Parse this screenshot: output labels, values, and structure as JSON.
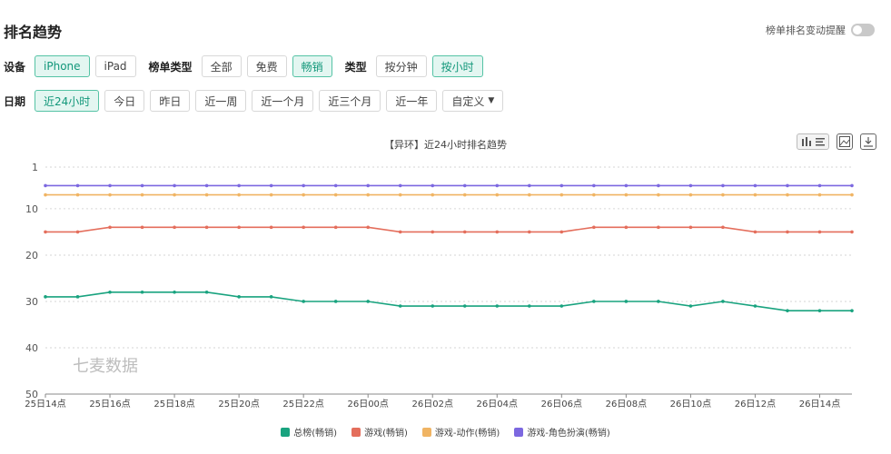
{
  "header": {
    "title": "排名趋势",
    "notify_label": "榜单排名变动提醒"
  },
  "filters": {
    "device_label": "设备",
    "devices": [
      {
        "label": "iPhone",
        "active": true
      },
      {
        "label": "iPad",
        "active": false
      }
    ],
    "list_type_label": "榜单类型",
    "list_types": [
      {
        "label": "全部",
        "active": false
      },
      {
        "label": "免费",
        "active": false
      },
      {
        "label": "畅销",
        "active": true
      }
    ],
    "type_label": "类型",
    "types": [
      {
        "label": "按分钟",
        "active": false
      },
      {
        "label": "按小时",
        "active": true
      }
    ],
    "date_label": "日期",
    "dates": [
      {
        "label": "近24小时",
        "active": true
      },
      {
        "label": "今日",
        "active": false
      },
      {
        "label": "昨日",
        "active": false
      },
      {
        "label": "近一周",
        "active": false
      },
      {
        "label": "近一个月",
        "active": false
      },
      {
        "label": "近三个月",
        "active": false
      },
      {
        "label": "近一年",
        "active": false
      }
    ],
    "custom_label": "自定义"
  },
  "watermark": "七麦数据",
  "chart_data": {
    "type": "line",
    "title": "【异环】近24小时排名趋势",
    "y_reversed": true,
    "ylim": [
      1,
      50
    ],
    "yticks": [
      1,
      10,
      20,
      30,
      40,
      50
    ],
    "x": [
      "25日14点",
      "25日15点",
      "25日16点",
      "25日17点",
      "25日18点",
      "25日19点",
      "25日20点",
      "25日21点",
      "25日22点",
      "25日23点",
      "26日00点",
      "26日01点",
      "26日02点",
      "26日03点",
      "26日04点",
      "26日05点",
      "26日06点",
      "26日07点",
      "26日08点",
      "26日09点",
      "26日10点",
      "26日11点",
      "26日12点",
      "26日13点",
      "26日14点",
      "26日15点"
    ],
    "xticks": [
      "25日14点",
      "25日16点",
      "25日18点",
      "25日20点",
      "25日22点",
      "26日00点",
      "26日02点",
      "26日04点",
      "26日06点",
      "26日08点",
      "26日10点",
      "26日12点",
      "26日14点"
    ],
    "grid": true,
    "legend_position": "bottom",
    "series": [
      {
        "name": "总榜(畅销)",
        "color": "#19a37f",
        "values": [
          29,
          29,
          28,
          28,
          28,
          28,
          29,
          29,
          30,
          30,
          30,
          31,
          31,
          31,
          31,
          31,
          31,
          30,
          30,
          30,
          31,
          30,
          31,
          32,
          32,
          32
        ]
      },
      {
        "name": "游戏(畅销)",
        "color": "#e46e5c",
        "values": [
          15,
          15,
          14,
          14,
          14,
          14,
          14,
          14,
          14,
          14,
          14,
          15,
          15,
          15,
          15,
          15,
          15,
          14,
          14,
          14,
          14,
          14,
          15,
          15,
          15,
          15
        ]
      },
      {
        "name": "游戏-动作(畅销)",
        "color": "#f0b463",
        "values": [
          7,
          7,
          7,
          7,
          7,
          7,
          7,
          7,
          7,
          7,
          7,
          7,
          7,
          7,
          7,
          7,
          7,
          7,
          7,
          7,
          7,
          7,
          7,
          7,
          7,
          7
        ]
      },
      {
        "name": "游戏-角色扮演(畅销)",
        "color": "#7c68e0",
        "values": [
          5,
          5,
          5,
          5,
          5,
          5,
          5,
          5,
          5,
          5,
          5,
          5,
          5,
          5,
          5,
          5,
          5,
          5,
          5,
          5,
          5,
          5,
          5,
          5,
          5,
          5
        ]
      }
    ]
  }
}
